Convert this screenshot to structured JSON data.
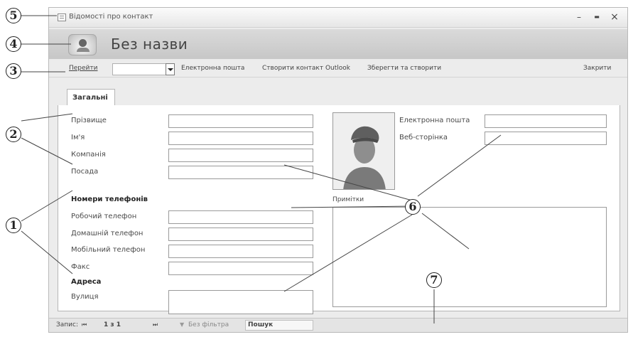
{
  "window": {
    "title": "Відомості про контакт",
    "controls": {
      "minimize": "–",
      "maximize": "▬",
      "close": "×"
    }
  },
  "header": {
    "icon": "contact-card-icon",
    "title": "Без назви"
  },
  "toolbar": {
    "goto_label": "Перейти",
    "goto_value": "",
    "email_label": "Електронна пошта",
    "outlook_label": "Створити контакт Outlook",
    "save_new_label": "Зберегти та створити",
    "close_label": "Закрити"
  },
  "tabs": [
    {
      "label": "Загальні",
      "active": true
    }
  ],
  "fields": {
    "last_name": {
      "label": "Прізвище",
      "value": ""
    },
    "first_name": {
      "label": "Ім'я",
      "value": ""
    },
    "company": {
      "label": "Компанія",
      "value": ""
    },
    "job_title": {
      "label": "Посада",
      "value": ""
    },
    "phones_heading": "Номери телефонів",
    "work_phone": {
      "label": "Робочий телефон",
      "value": ""
    },
    "home_phone": {
      "label": "Домашній телефон",
      "value": ""
    },
    "mobile_phone": {
      "label": "Мобільний телефон",
      "value": ""
    },
    "fax": {
      "label": "Факс",
      "value": ""
    },
    "address_heading": "Адреса",
    "street": {
      "label": "Вулиця",
      "value": ""
    },
    "email": {
      "label": "Електронна пошта",
      "value": ""
    },
    "web_page": {
      "label": "Веб-сторінка",
      "value": ""
    },
    "notes": {
      "label": "Примітки",
      "value": ""
    }
  },
  "statusbar": {
    "record_label": "Запис:",
    "first_icon": "first-record-icon",
    "position": "1 з 1",
    "last_icon": "last-record-icon",
    "filter_label": "Без фільтра",
    "search_label": "Пошук"
  },
  "callouts": [
    "1",
    "2",
    "3",
    "4",
    "5",
    "6",
    "7"
  ]
}
